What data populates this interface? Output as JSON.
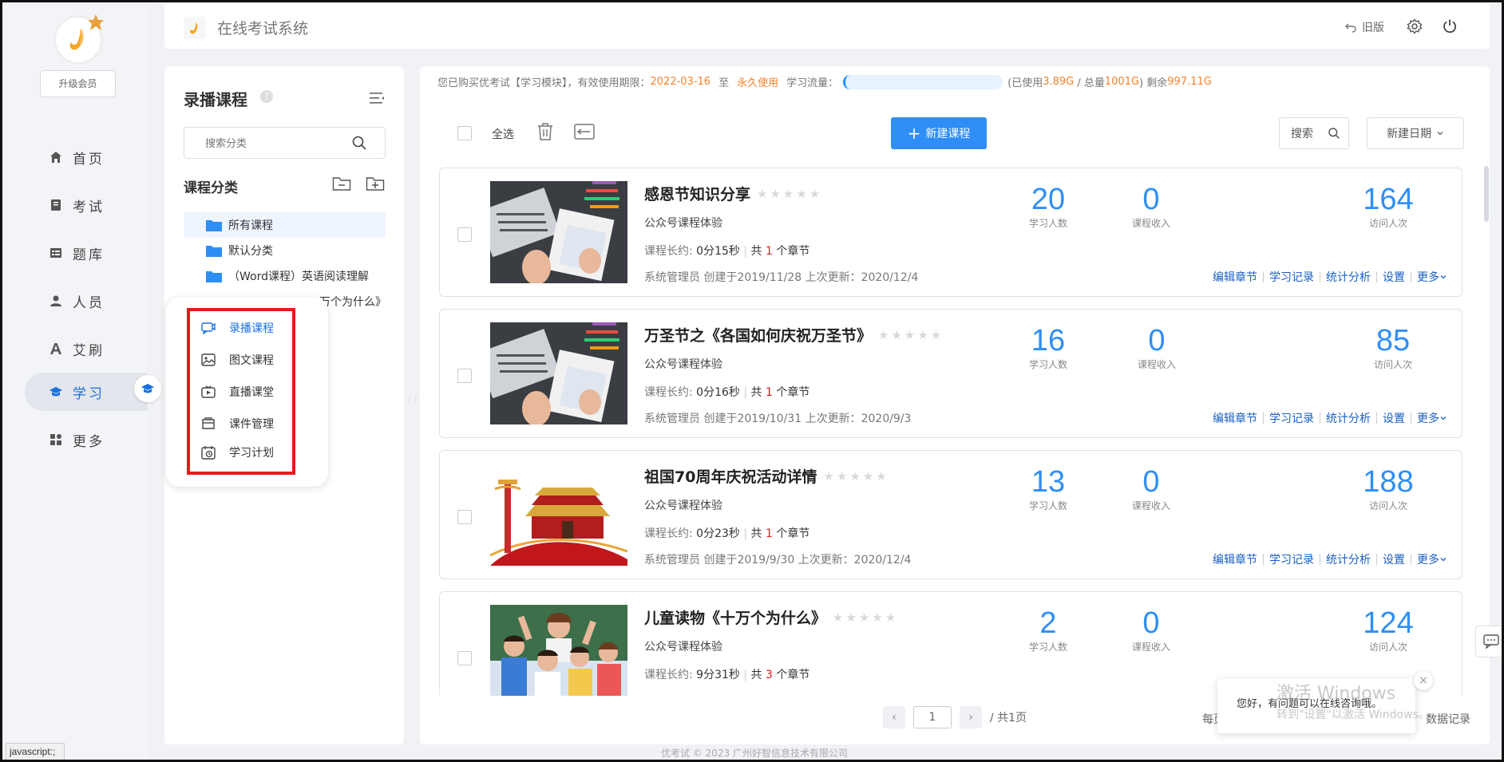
{
  "app": {
    "title": "在线考试系统",
    "old_version": "旧版"
  },
  "sidebar": {
    "upgrade": "升级会员",
    "items": [
      {
        "label": "首页",
        "icon": "home-icon"
      },
      {
        "label": "考试",
        "icon": "exam-icon"
      },
      {
        "label": "题库",
        "icon": "question-bank-icon"
      },
      {
        "label": "人员",
        "icon": "person-icon"
      },
      {
        "label": "艾刷",
        "icon": "letter-a-icon"
      },
      {
        "label": "学习",
        "icon": "graduation-cap-icon",
        "active": true
      },
      {
        "label": "更多",
        "icon": "grid-icon"
      }
    ]
  },
  "catpanel": {
    "title": "录播课程",
    "search_placeholder": "搜索分类",
    "category_heading": "课程分类",
    "tree": [
      "所有课程",
      "默认分类",
      "（Word课程）英语阅读理解",
      "万个为什么》"
    ]
  },
  "popup": {
    "items": [
      {
        "label": "录播课程",
        "icon": "video-chat-icon",
        "active": true
      },
      {
        "label": "图文课程",
        "icon": "image-icon"
      },
      {
        "label": "直播课堂",
        "icon": "live-tv-icon"
      },
      {
        "label": "课件管理",
        "icon": "folder-box-icon"
      },
      {
        "label": "学习计划",
        "icon": "alarm-clock-icon"
      }
    ]
  },
  "notice": {
    "prefix": "您已购买优考试【学习模块】，有效使用期限：",
    "start": "2022-03-16",
    "to": "至",
    "end": "永久使用",
    "flow_label": "学习流量：",
    "used_prefix": "(已使用",
    "used": "3.89G",
    "total_prefix": " / 总量",
    "total": "1001G",
    "remain_prefix": ") 剩余",
    "remain": "997.11G",
    "used_fraction": 0.004
  },
  "toolbar": {
    "select_all": "全选",
    "new_course": "新建课程",
    "search": "搜索",
    "sort": "新建日期"
  },
  "courses": [
    {
      "title": "感恩节知识分享",
      "subtitle": "公众号课程体验",
      "dur_label": "课程长约:",
      "duration": "0分15秒",
      "chap_pre": "共",
      "chapters": "1",
      "chap_post": "个章节",
      "meta": "系统管理员 创建于2019/11/28  上次更新：2020/12/4",
      "learners": "20",
      "income": "0",
      "visits": "164",
      "thumb": "laptop"
    },
    {
      "title": "万圣节之《各国如何庆祝万圣节》",
      "subtitle": "公众号课程体验",
      "dur_label": "课程长约:",
      "duration": "0分16秒",
      "chap_pre": "共",
      "chapters": "1",
      "chap_post": "个章节",
      "meta": "系统管理员 创建于2019/10/31  上次更新：2020/9/3",
      "learners": "16",
      "income": "0",
      "visits": "85",
      "thumb": "laptop"
    },
    {
      "title": "祖国70周年庆祝活动详情",
      "subtitle": "公众号课程体验",
      "dur_label": "课程长约:",
      "duration": "0分23秒",
      "chap_pre": "共",
      "chapters": "1",
      "chap_post": "个章节",
      "meta": "系统管理员 创建于2019/9/30  上次更新：2020/12/4",
      "learners": "13",
      "income": "0",
      "visits": "188",
      "thumb": "tiananmen"
    },
    {
      "title": "儿童读物《十万个为什么》",
      "subtitle": "公众号课程体验",
      "dur_label": "课程长约:",
      "duration": "9分31秒",
      "chap_pre": "共",
      "chapters": "3",
      "chap_post": "个章节",
      "meta": "",
      "learners": "2",
      "income": "0",
      "visits": "124",
      "thumb": "kids"
    }
  ],
  "stat_labels": {
    "learners": "学习人数",
    "income": "课程收入",
    "visits": "访问人次"
  },
  "actions": [
    "编辑章节",
    "学习记录",
    "统计分析",
    "设置",
    "更多"
  ],
  "pagination": {
    "page": "1",
    "total": "/ 共1页",
    "per_page": "每页",
    "records": "数据记录"
  },
  "footer": "优考试 © 2023 广州好智信息技术有限公司",
  "statusbar": "javascript:;",
  "chat": {
    "message": "您好，有问题可以在线咨询哦。",
    "close": "×"
  },
  "watermark": {
    "line1": "激活 Windows",
    "line2": "转到\"设置\"以激活 Windows。"
  },
  "colors": {
    "accent": "#2f8ef6",
    "orange": "#f5812b",
    "red": "#e8191c"
  }
}
